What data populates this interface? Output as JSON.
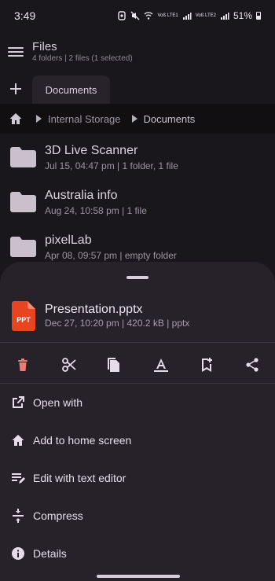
{
  "status": {
    "time": "3:49",
    "carrier1": "Voß LTE1",
    "carrier2": "Voß LTE2",
    "battery": "51%"
  },
  "appbar": {
    "title": "Files",
    "subtitle": "4 folders | 2 files (1 selected)"
  },
  "tabs": [
    {
      "label": "Documents"
    }
  ],
  "breadcrumb": {
    "items": [
      "Internal Storage",
      "Documents"
    ]
  },
  "files": [
    {
      "name": "3D Live Scanner",
      "meta": "Jul 15, 04:47 pm | 1 folder, 1 file"
    },
    {
      "name": "Australia info",
      "meta": "Aug 24, 10:58 pm | 1 file"
    },
    {
      "name": "pixelLab",
      "meta": "Apr 08, 09:57 pm | empty folder"
    }
  ],
  "sheet": {
    "file_icon_label": "PPT",
    "file_name": "Presentation.pptx",
    "file_meta": "Dec 27, 10:20 pm | 420.2 kB | pptx",
    "actions": [
      "delete-icon",
      "cut-icon",
      "copy-icon",
      "rename-icon",
      "bookmark-add-icon",
      "share-icon"
    ],
    "menu": [
      {
        "label": "Open with",
        "icon": "open-external-icon"
      },
      {
        "label": "Add to home screen",
        "icon": "home-icon"
      },
      {
        "label": "Edit with text editor",
        "icon": "edit-text-icon"
      },
      {
        "label": "Compress",
        "icon": "compress-icon"
      },
      {
        "label": "Details",
        "icon": "info-icon"
      }
    ]
  },
  "colors": {
    "background": "#1a171c",
    "sheet": "#272229",
    "folder": "#c9c0cc",
    "ppt_red": "#e8441f",
    "delete_red": "#f07a74"
  }
}
